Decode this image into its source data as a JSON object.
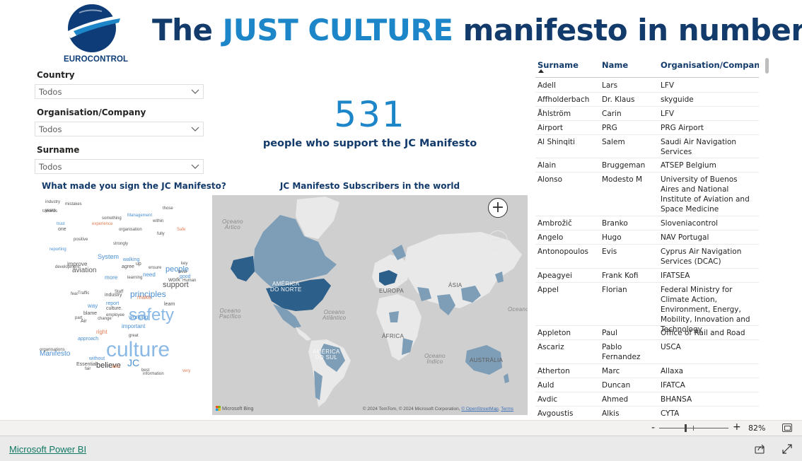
{
  "logo": {
    "text": "EUROCONTROL",
    "colors": {
      "primary": "#0d3c78",
      "accent": "#1d86c8"
    }
  },
  "header": {
    "title_pre": "The ",
    "title_accent": "JUST CULTURE",
    "title_post": " manifesto in numbers"
  },
  "filters": {
    "country": {
      "label": "Country",
      "value": "Todos"
    },
    "organisation": {
      "label": "Organisation/Company",
      "value": "Todos"
    },
    "surname": {
      "label": "Surname",
      "value": "Todos"
    }
  },
  "kpi": {
    "value": "531",
    "label": "people who support the JC Manifesto"
  },
  "wordcloud": {
    "title": "What made you sign the JC Manifesto?",
    "words": [
      {
        "t": "culture",
        "c": "#8bb9e6"
      },
      {
        "t": "safety",
        "c": "#8bb9e6"
      },
      {
        "t": "principles",
        "c": "#4a8fd1"
      },
      {
        "t": "Manifesto",
        "c": "#4a8fd1"
      },
      {
        "t": "aviation",
        "c": "#555555"
      },
      {
        "t": "believe",
        "c": "#333333"
      },
      {
        "t": "JC",
        "c": "#4a8fd1"
      },
      {
        "t": "support",
        "c": "#555555"
      },
      {
        "t": "people",
        "c": "#4a8fd1"
      },
      {
        "t": "System",
        "c": "#4a8fd1"
      },
      {
        "t": "improve",
        "c": "#555555"
      },
      {
        "t": "more",
        "c": "#4a8fd1"
      },
      {
        "t": "way",
        "c": "#4a8fd1"
      },
      {
        "t": "important",
        "c": "#4a8fd1"
      },
      {
        "t": "right",
        "c": "#e07b52"
      },
      {
        "t": "work",
        "c": "#555555"
      },
      {
        "t": "agree",
        "c": "#555555"
      },
      {
        "t": "learning",
        "c": "#555555"
      },
      {
        "t": "Human",
        "c": "#555555"
      },
      {
        "t": "Safe",
        "c": "#e07b52"
      },
      {
        "t": "without",
        "c": "#4a8fd1"
      },
      {
        "t": "Essential",
        "c": "#555555"
      },
      {
        "t": "industry",
        "c": "#555555"
      },
      {
        "t": "culture.",
        "c": "#555555"
      },
      {
        "t": "blame",
        "c": "#555555"
      },
      {
        "t": "approach",
        "c": "#4a8fd1"
      },
      {
        "t": "need",
        "c": "#4a8fd1"
      },
      {
        "t": "good",
        "c": "#4a8fd1"
      },
      {
        "t": "make",
        "c": "#e07b52"
      },
      {
        "t": "learn",
        "c": "#555555"
      },
      {
        "t": "Management",
        "c": "#4a8fd1"
      },
      {
        "t": "experience",
        "c": "#e07b52"
      },
      {
        "t": "organisation",
        "c": "#555555"
      },
      {
        "t": "strongly",
        "c": "#555555"
      },
      {
        "t": "reporting",
        "c": "#4a8fd1"
      },
      {
        "t": "development",
        "c": "#555555"
      },
      {
        "t": "change",
        "c": "#555555"
      },
      {
        "t": "Traffic",
        "c": "#555555"
      },
      {
        "t": "organisations",
        "c": "#555555"
      },
      {
        "t": "Air",
        "c": "#555555"
      },
      {
        "t": "trust",
        "c": "#4a8fd1"
      },
      {
        "t": "industry",
        "c": "#555555"
      },
      {
        "t": "mistakes",
        "c": "#555555"
      },
      {
        "t": "years",
        "c": "#555555"
      },
      {
        "t": "towards",
        "c": "#555555"
      },
      {
        "t": "one",
        "c": "#555555"
      },
      {
        "t": "fully",
        "c": "#555555"
      },
      {
        "t": "positive",
        "c": "#555555"
      },
      {
        "t": "something",
        "c": "#555555"
      },
      {
        "t": "within",
        "c": "#555555"
      },
      {
        "t": "those",
        "c": "#555555"
      },
      {
        "t": "ensure",
        "c": "#555555"
      },
      {
        "t": "key",
        "c": "#555555"
      },
      {
        "t": "Staff",
        "c": "#555555"
      },
      {
        "t": "employee",
        "c": "#555555"
      },
      {
        "t": "fear",
        "c": "#555555"
      },
      {
        "t": "part",
        "c": "#555555"
      },
      {
        "t": "fair",
        "c": "#555555"
      },
      {
        "t": "also",
        "c": "#e07b52"
      },
      {
        "t": "best",
        "c": "#555555"
      },
      {
        "t": "information",
        "c": "#555555"
      },
      {
        "t": "very",
        "c": "#e07b52"
      },
      {
        "t": "walking",
        "c": "#4a8fd1"
      },
      {
        "t": "up",
        "c": "#555555"
      },
      {
        "t": "working",
        "c": "#4a8fd1"
      },
      {
        "t": "report",
        "c": "#4a8fd1"
      },
      {
        "t": "level",
        "c": "#555555"
      },
      {
        "t": "great",
        "c": "#555555"
      }
    ]
  },
  "map": {
    "title": "JC Manifesto Subscribers in the world",
    "labels": {
      "atlantic_n": "Oceano\nÁrtico",
      "pacific": "Oceano\nPacífico",
      "atlantic": "Oceano\nAtlântico",
      "indian": "Oceano\nÍndico",
      "pacific_e": "Oceano",
      "n_america": "AMÉRICA\nDO NORTE",
      "s_america": "AMÉRICA\nDO SUL",
      "europe": "EUROPA",
      "asia": "ÁSIA",
      "africa": "ÁFRICA",
      "australia": "AUSTRÁLIA"
    },
    "bing": "Microsoft Bing",
    "attribution_pre": "© 2024 TomTom, © 2024 Microsoft Corporation, ",
    "attribution_osm": "© OpenStreetMap",
    "attribution_terms": "Terms",
    "zoom_in": "+",
    "zoom_out": "−",
    "colors": {
      "land": "#e9e9e9",
      "water": "#cfcfcf",
      "subscriber_light": "#7e9eb8",
      "subscriber_dark": "#2c5f8a"
    }
  },
  "table": {
    "columns": [
      "Surname",
      "Name",
      "Organisation/Company"
    ],
    "sort_column": "Surname",
    "rows": [
      [
        "Adell",
        "Lars",
        "LFV"
      ],
      [
        "Affholderbach",
        "Dr. Klaus",
        "skyguide"
      ],
      [
        "Åhlström",
        "Carin",
        "LFV"
      ],
      [
        "Airport",
        "PRG",
        "PRG Airport"
      ],
      [
        "Al Shinqiti",
        "Salem",
        "Saudi Air Navigation Services"
      ],
      [
        "Alain",
        "Bruggeman",
        "ATSEP Belgium"
      ],
      [
        "Alonso",
        "Modesto M",
        "University of Buenos Aires and National Institute of Aviation and Space Medicine"
      ],
      [
        "Ambrožič",
        "Branko",
        "Sloveniacontrol"
      ],
      [
        "Angelo",
        "Hugo",
        "NAV Portugal"
      ],
      [
        "Antonopoulos",
        "Evis",
        "Cyprus Air Navigation Services (DCAC)"
      ],
      [
        "Apeagyei",
        "Frank Kofi",
        "IFATSEA"
      ],
      [
        "Appel",
        "Florian",
        "Federal Ministry for Climate Action, Environment, Energy, Mobility, Innovation and Technology"
      ],
      [
        "Appleton",
        "Paul",
        "Office of Rail and Road"
      ],
      [
        "Ascariz",
        "Pablo Fernandez",
        "USCA"
      ],
      [
        "Atherton",
        "Marc",
        "Allaxa"
      ],
      [
        "Auld",
        "Duncan",
        "IFATCA"
      ],
      [
        "Avdic",
        "Ahmed",
        "BHANSA"
      ],
      [
        "Avgoustis",
        "Alkis",
        "CYTA"
      ]
    ]
  },
  "zoombar": {
    "minus": "-",
    "plus": "+",
    "zoom": "82%",
    "level": 0.82
  },
  "footer": {
    "link": "Microsoft Power BI"
  }
}
